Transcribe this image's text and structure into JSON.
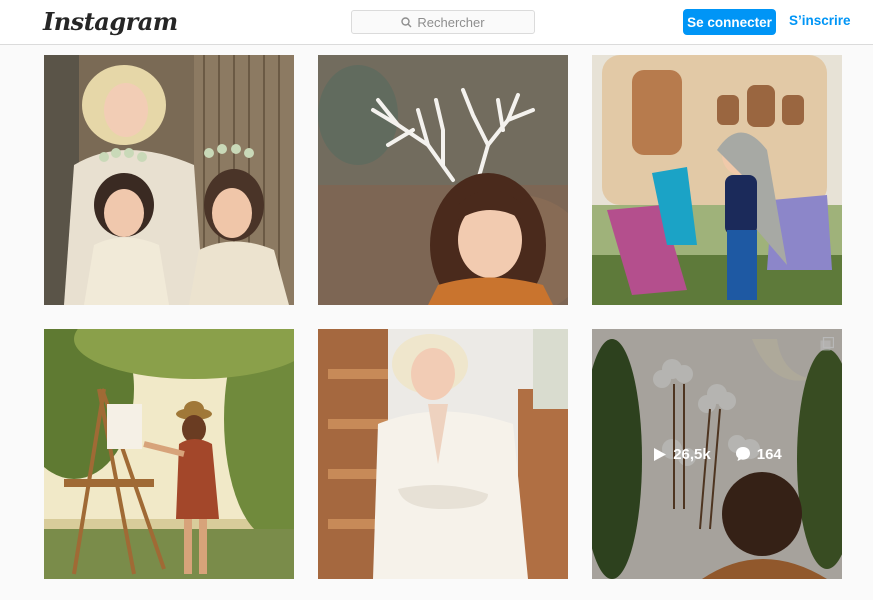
{
  "header": {
    "logo": "Instagram",
    "search_placeholder": "Rechercher",
    "login_label": "Se connecter",
    "signup_label": "S’inscrire"
  },
  "posts": [
    {
      "alt": "photo-mother-daughters-flower-crowns"
    },
    {
      "alt": "photo-girl-with-antlers"
    },
    {
      "alt": "photo-child-headdress-deckchairs"
    },
    {
      "alt": "photo-girl-painting-easel"
    },
    {
      "alt": "photo-woman-white-stairs"
    },
    {
      "alt": "photo-child-wall-decor",
      "plays": "26,5k",
      "comments": "164"
    }
  ],
  "colors": {
    "accent": "#0095f6",
    "border": "#dbdbdb",
    "background": "#fafafa"
  }
}
